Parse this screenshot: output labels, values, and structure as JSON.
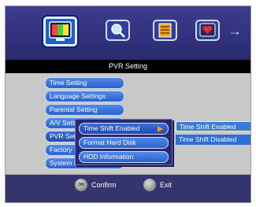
{
  "header": {
    "title": "PVR Setting",
    "icons": [
      "tv-icon",
      "search-icon",
      "channel-list-icon",
      "heart-icon",
      "arrow-right-icon"
    ],
    "selected_icon": "tv-icon"
  },
  "menu": {
    "items": [
      {
        "label": "Time Setting"
      },
      {
        "label": "Language Settings"
      },
      {
        "label": "Parental Setting"
      },
      {
        "label": "A/V Setting"
      },
      {
        "label": "PVR Setting"
      },
      {
        "label": "Factory"
      },
      {
        "label": "System Info"
      }
    ],
    "active_index": 4
  },
  "submenu": {
    "items": [
      {
        "label": "Time Shift Enabled"
      },
      {
        "label": "Format Hard Disk"
      },
      {
        "label": "HDD Information"
      }
    ],
    "active_index": 0
  },
  "options": {
    "items": [
      {
        "label": "Time Shift Enabled"
      },
      {
        "label": "Time Shift Disabled"
      }
    ],
    "selected_index": 0
  },
  "footer": {
    "confirm_key": "OK",
    "confirm_label": "Confirm",
    "exit_label": "Exit"
  },
  "colors": {
    "accent_blue": "#2d6fd6",
    "highlight_yellow": "#ffff66",
    "arrow_orange": "#ff9a1a"
  }
}
